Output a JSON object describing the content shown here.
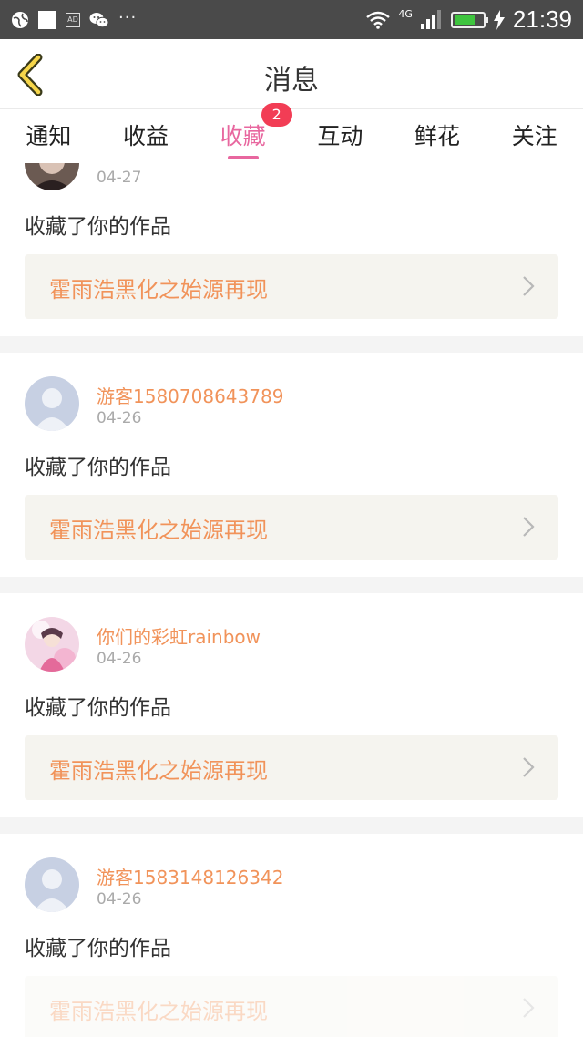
{
  "status_bar": {
    "icons": [
      "globe-icon",
      "square-icon",
      "ad-icon",
      "wechat-icon",
      "more-dots-icon",
      "wifi-icon",
      "signal-icon",
      "battery-icon",
      "charging-icon"
    ],
    "network": "4G",
    "time": "21:39",
    "battery_level": 0.75
  },
  "header": {
    "title": "消息",
    "back_icon": "chevron-left-icon",
    "accent": "#e8679f"
  },
  "tabs": [
    {
      "label": "通知"
    },
    {
      "label": "收益"
    },
    {
      "label": "收藏",
      "active": true,
      "badge": "2"
    },
    {
      "label": "互动"
    },
    {
      "label": "鲜花"
    },
    {
      "label": "关注"
    }
  ],
  "messages": [
    {
      "user": "",
      "date": "04-27",
      "action": "收藏了你的作品",
      "work": "霍雨浩黑化之始源再现"
    },
    {
      "user": "游客1580708643789",
      "date": "04-26",
      "action": "收藏了你的作品",
      "work": "霍雨浩黑化之始源再现"
    },
    {
      "user": "你们的彩虹rainbow",
      "date": "04-26",
      "action": "收藏了你的作品",
      "work": "霍雨浩黑化之始源再现"
    },
    {
      "user": "游客1583148126342",
      "date": "04-26",
      "action": "收藏了你的作品",
      "work": "霍雨浩黑化之始源再现"
    }
  ],
  "colors": {
    "username": "#f1935a",
    "badge": "#f23d55",
    "status_bar": "#4a4a4a"
  }
}
